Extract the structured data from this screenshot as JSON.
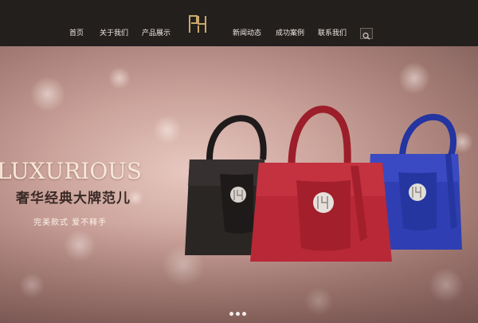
{
  "nav": {
    "left": [
      "首页",
      "关于我们",
      "产品展示"
    ],
    "right": [
      "新闻动态",
      "成功案例",
      "联系我们"
    ]
  },
  "hero": {
    "headline": "LUXURIOUS",
    "subheadline": "奢华经典大牌范儿",
    "tagline": "完美款式 爱不释手"
  },
  "carousel": {
    "slides": 3,
    "active": 0
  },
  "icons": [
    "brand-logo-icon",
    "search-icon"
  ],
  "colors": {
    "topbar": "#231f1d",
    "headline": "#f7e8d6",
    "accent_gold": "#c9a86b"
  }
}
